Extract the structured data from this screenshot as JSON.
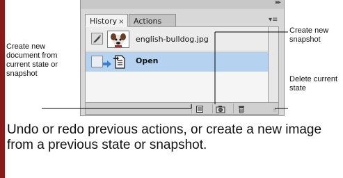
{
  "panel": {
    "tabs": [
      {
        "label": "History",
        "close": "×"
      },
      {
        "label": "Actions"
      }
    ],
    "collapse_glyph": "▸▸",
    "menu_glyph": "▾≡",
    "snapshot": {
      "label": "english-bulldog.jpg"
    },
    "states": [
      {
        "label": "Open"
      }
    ],
    "footer_buttons": [
      {
        "name": "new-document-from-state",
        "icon": "new-document-icon"
      },
      {
        "name": "create-new-snapshot",
        "icon": "camera-icon"
      },
      {
        "name": "delete-current-state",
        "icon": "trash-icon"
      }
    ]
  },
  "callouts": {
    "left": "Create new document from current state or snapshot",
    "right_top": "Create new snapshot",
    "right_bottom": "Delete current state"
  },
  "caption": "Undo or redo previous actions, or create a new image from a previous state or snapshot.",
  "colors": {
    "accent_bar": "#8b1a1a",
    "selected_row": "#b5d3f0",
    "panel_bg": "#d8d8d8"
  }
}
